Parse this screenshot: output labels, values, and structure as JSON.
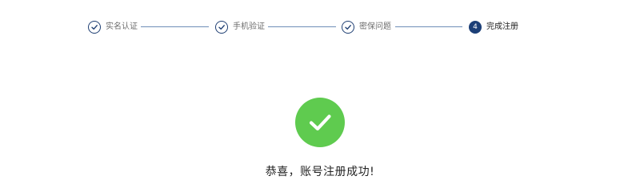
{
  "steps": [
    {
      "label": "实名认证",
      "status": "done"
    },
    {
      "label": "手机验证",
      "status": "done"
    },
    {
      "label": "密保问题",
      "status": "done"
    },
    {
      "number": "4",
      "label": "完成注册",
      "status": "current"
    }
  ],
  "result": {
    "icon": "check-circle-icon",
    "message": "恭喜，账号注册成功!"
  },
  "colors": {
    "primary": "#1c3f77",
    "success": "#5fcb4f",
    "connector": "#6f8fb8"
  }
}
